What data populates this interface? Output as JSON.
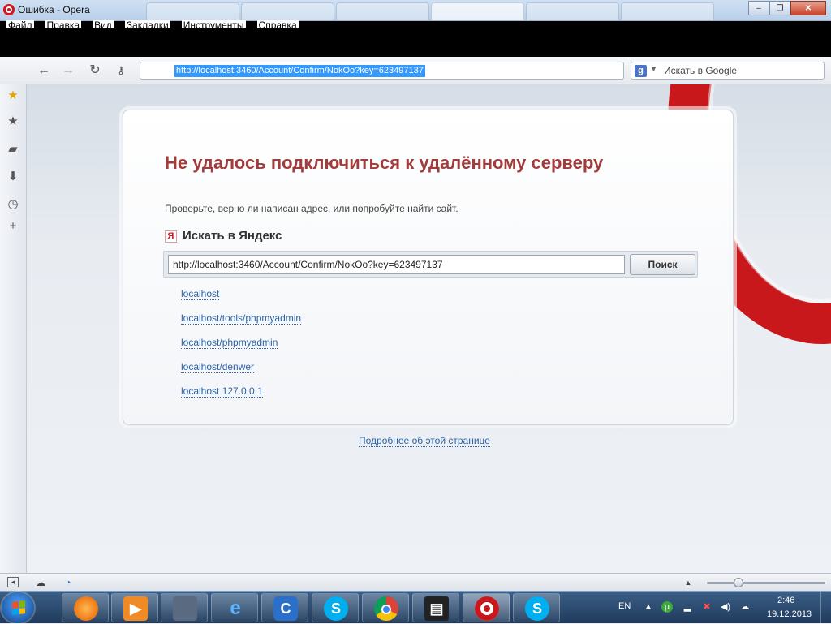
{
  "window": {
    "title": "Ошибка - Opera",
    "controls": {
      "minimize": "‒",
      "maximize": "❐",
      "close": "✕"
    }
  },
  "menu": {
    "items": [
      "Файл",
      "Правка",
      "Вид",
      "Закладки",
      "Инструменты",
      "Справка"
    ]
  },
  "toolbar": {
    "icons": {
      "back": "back-arrow-icon",
      "forward": "forward-arrow-icon",
      "reload": "reload-icon",
      "key": "key-icon"
    },
    "url": "http://localhost:3460/Account/Confirm/NokOo?key=623497137",
    "search_engine_letter": "g",
    "search_placeholder": "Искать в Google"
  },
  "sidebar": {
    "icons": [
      "speed-dial-icon",
      "bookmarks-icon",
      "notes-icon",
      "downloads-icon",
      "history-icon",
      "add-panel-icon"
    ]
  },
  "error_page": {
    "title": "Не удалось подключиться к удалённому серверу",
    "description": "Проверьте, верно ли написан адрес, или попробуйте найти сайт.",
    "yandex_logo": "Я",
    "search_heading": "Искать в Яндекс",
    "search_value": "http://localhost:3460/Account/Confirm/NokOo?key=623497137",
    "search_button": "Поиск",
    "suggestions": [
      "localhost",
      "localhost/tools/phpmyadmin",
      "localhost/phpmyadmin",
      "localhost/denwer",
      "localhost 127.0.0.1"
    ],
    "more_link": "Подробнее об этой странице",
    "accent_color": "#a23b3b",
    "link_color": "#2b64a8",
    "brand_color": "#c9181c"
  },
  "statusbar": {
    "zoom_fraction": 0.27
  },
  "taskbar": {
    "apps": [
      "firefox-icon",
      "media-player-icon",
      "game-icon",
      "internet-explorer-icon",
      "app-icon",
      "skype-icon",
      "chrome-icon",
      "printer-icon",
      "opera-icon",
      "skype-icon"
    ],
    "language": "EN",
    "time": "2:46",
    "date": "19.12.2013"
  }
}
